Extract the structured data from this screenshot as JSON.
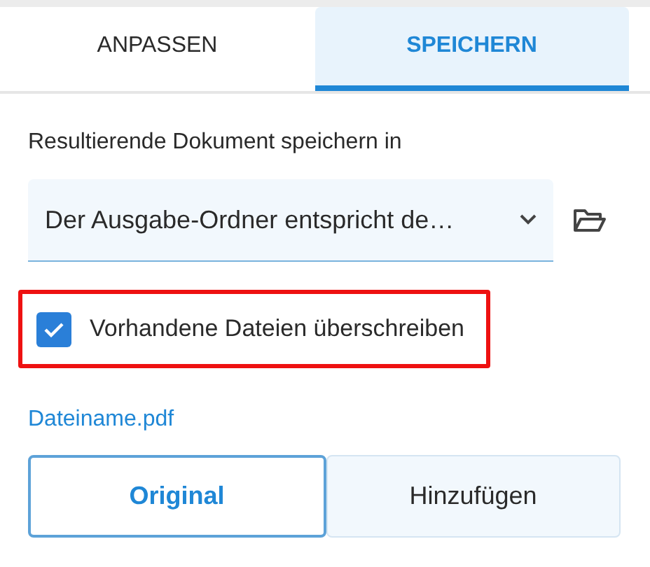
{
  "tabs": [
    {
      "label": "ANPASSEN",
      "selected": false
    },
    {
      "label": "SPEICHERN",
      "selected": true
    }
  ],
  "save_location": {
    "label": "Resultierende Dokument speichern in",
    "value": "Der Ausgabe-Ordner entspricht de…"
  },
  "overwrite": {
    "label": "Vorhandene Dateien überschreiben",
    "checked": true,
    "highlighted": true
  },
  "filename": "Dateiname.pdf",
  "mode_options": [
    {
      "label": "Original",
      "selected": true
    },
    {
      "label": "Hinzufügen",
      "selected": false
    }
  ]
}
